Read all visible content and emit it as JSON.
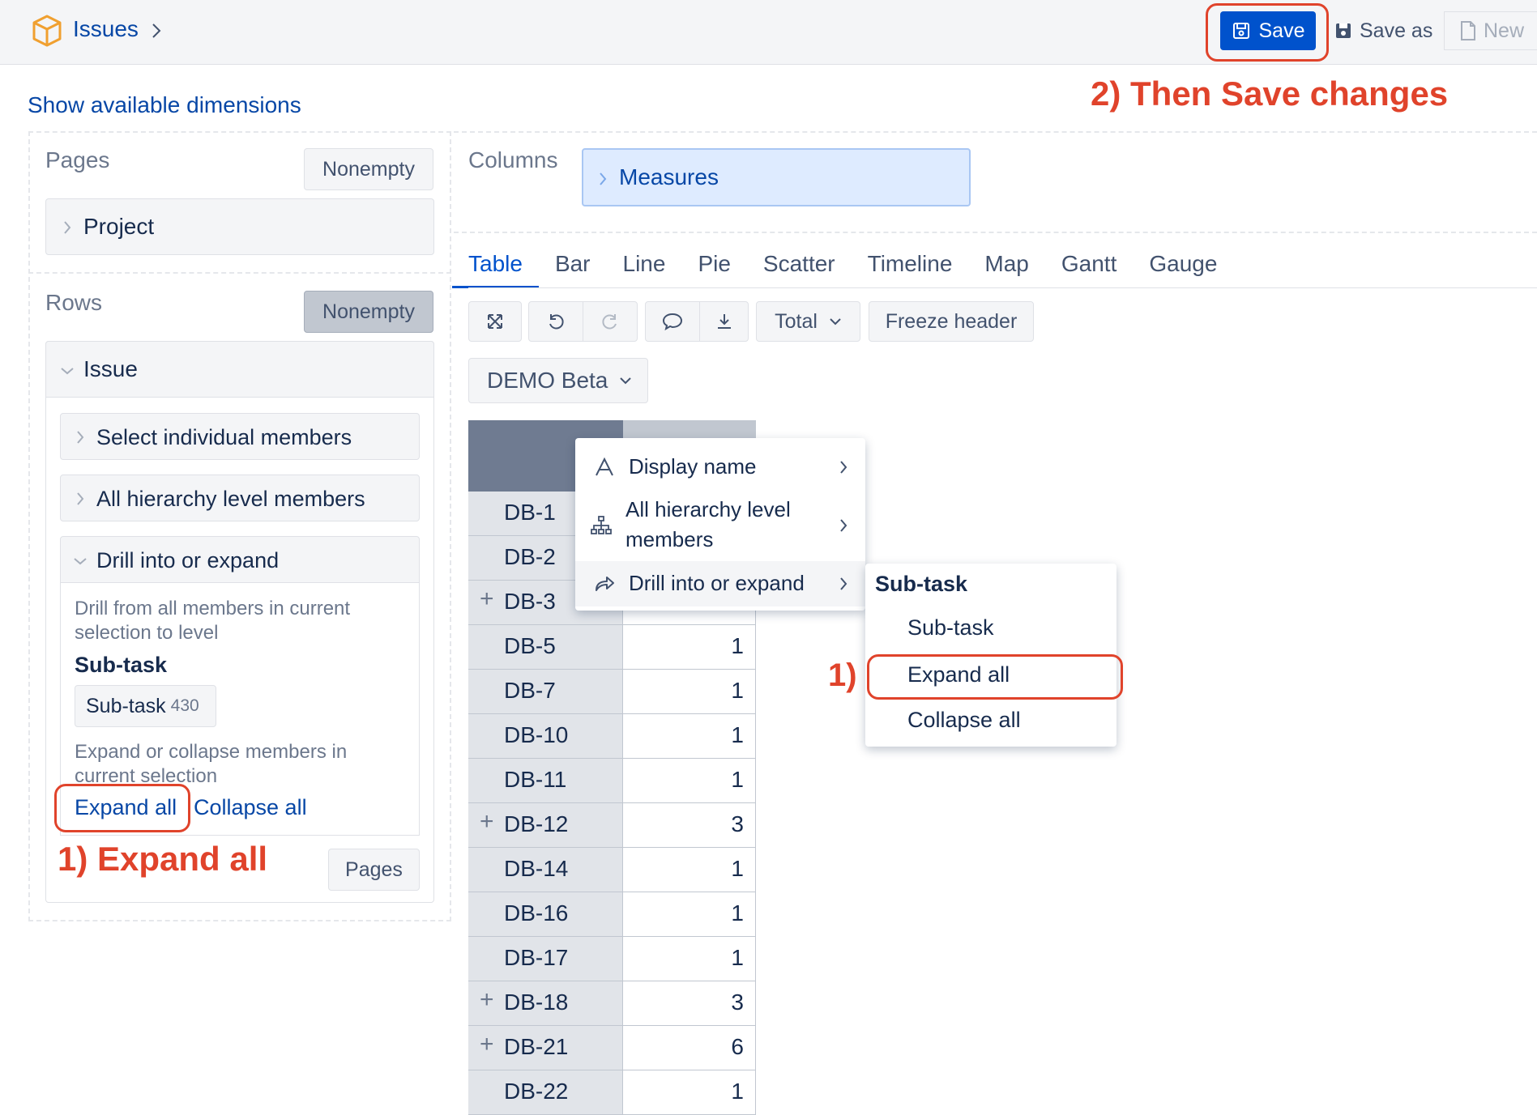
{
  "header": {
    "breadcrumb": "Issues",
    "save_label": "Save",
    "save_as_label": "Save as",
    "new_label": "New"
  },
  "annotations": {
    "then_save": "2) Then Save changes",
    "expand_all": "1) Expand all",
    "menu_step": "1)"
  },
  "show_dimensions": "Show available dimensions",
  "pages": {
    "label": "Pages",
    "nonempty": "Nonempty",
    "dimension": "Project"
  },
  "rows": {
    "label": "Rows",
    "nonempty": "Nonempty",
    "dimension": "Issue",
    "options": {
      "select_members": "Select individual members",
      "all_hierarchy": "All hierarchy level members",
      "drill": "Drill into or expand"
    },
    "drill_panel": {
      "description": "Drill from all members in current selection to level",
      "level_heading": "Sub-task",
      "chip_label": "Sub-task",
      "chip_count": "430",
      "expand_desc": "Expand or collapse members in current selection",
      "expand_all": "Expand all",
      "collapse_all": "Collapse all",
      "pages_button": "Pages"
    }
  },
  "columns": {
    "label": "Columns",
    "dimension": "Measures"
  },
  "view_tabs": [
    "Table",
    "Bar",
    "Line",
    "Pie",
    "Scatter",
    "Timeline",
    "Map",
    "Gantt",
    "Gauge"
  ],
  "toolbar": {
    "total_label": "Total",
    "freeze_header": "Freeze header"
  },
  "selector": "DEMO Beta",
  "table": {
    "rows": [
      {
        "name": "DB-1",
        "value": "",
        "expandable": false
      },
      {
        "name": "DB-2",
        "value": "",
        "expandable": false
      },
      {
        "name": "DB-3",
        "value": "",
        "expandable": true
      },
      {
        "name": "DB-5",
        "value": "1",
        "expandable": false
      },
      {
        "name": "DB-7",
        "value": "1",
        "expandable": false
      },
      {
        "name": "DB-10",
        "value": "1",
        "expandable": false
      },
      {
        "name": "DB-11",
        "value": "1",
        "expandable": false
      },
      {
        "name": "DB-12",
        "value": "3",
        "expandable": true
      },
      {
        "name": "DB-14",
        "value": "1",
        "expandable": false
      },
      {
        "name": "DB-16",
        "value": "1",
        "expandable": false
      },
      {
        "name": "DB-17",
        "value": "1",
        "expandable": false
      },
      {
        "name": "DB-18",
        "value": "3",
        "expandable": true
      },
      {
        "name": "DB-21",
        "value": "6",
        "expandable": true
      },
      {
        "name": "DB-22",
        "value": "1",
        "expandable": false
      }
    ]
  },
  "context_menu": {
    "display_name": "Display name",
    "all_hierarchy_line1": "All hierarchy level",
    "all_hierarchy_line2": "members",
    "drill": "Drill into or expand"
  },
  "submenu": {
    "heading": "Sub-task",
    "items": [
      "Sub-task",
      "Expand all",
      "Collapse all"
    ]
  },
  "colors": {
    "primary": "#0052cc",
    "annotation": "#e0432b",
    "link": "#0747a6"
  }
}
